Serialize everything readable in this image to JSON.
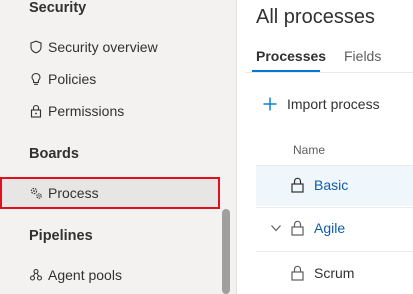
{
  "sidebar": {
    "sections": [
      {
        "title": "Security",
        "items": [
          {
            "label": "Security overview",
            "icon": "shield-icon"
          },
          {
            "label": "Policies",
            "icon": "lightbulb-icon"
          },
          {
            "label": "Permissions",
            "icon": "lock-icon"
          }
        ]
      },
      {
        "title": "Boards",
        "items": [
          {
            "label": "Process",
            "icon": "process-gear-icon",
            "selected": true
          }
        ]
      },
      {
        "title": "Pipelines",
        "items": [
          {
            "label": "Agent pools",
            "icon": "agent-pools-icon"
          }
        ]
      }
    ],
    "highlight_color": "#e0101e"
  },
  "main": {
    "title": "All processes",
    "tabs": [
      {
        "label": "Processes",
        "active": true
      },
      {
        "label": "Fields",
        "active": false
      }
    ],
    "import_button": {
      "label": "Import process",
      "icon": "plus-icon"
    },
    "table": {
      "column_header": "Name",
      "rows": [
        {
          "name": "Basic",
          "locked": true,
          "selected": true,
          "expandable": false,
          "link": true
        },
        {
          "name": "Agile",
          "locked": true,
          "selected": false,
          "expandable": true,
          "link": true
        },
        {
          "name": "Scrum",
          "locked": true,
          "selected": false,
          "expandable": false,
          "link": false
        }
      ]
    }
  },
  "colors": {
    "accent": "#0078d4",
    "link": "#0f5da8",
    "sidebar_bg": "#f3f2f1",
    "selected_row_bg": "#eff6fc"
  }
}
